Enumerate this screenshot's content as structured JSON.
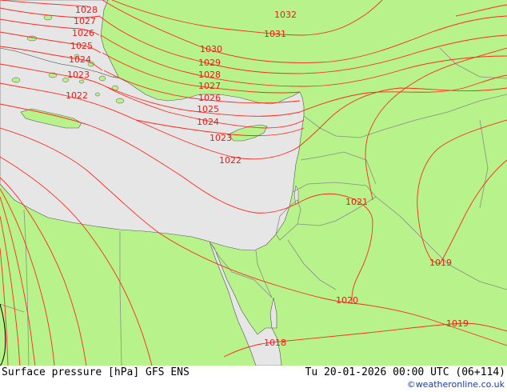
{
  "footer": {
    "left": "Surface pressure [hPa] GFS ENS",
    "right": "Tu 20-01-2026 00:00 UTC (06+114)",
    "credit": "©weatheronline.co.uk"
  },
  "colors": {
    "land": "#b7f28a",
    "sea": "#e6e6e6",
    "isobar": "#ff2a1f",
    "label": "#e0201c",
    "border": "#8c8c8c",
    "coast": "#555555"
  },
  "isobar_labels": [
    {
      "id": "1028a",
      "text": "1028"
    },
    {
      "id": "1027a",
      "text": "1027"
    },
    {
      "id": "1026a",
      "text": "1026"
    },
    {
      "id": "1025a",
      "text": "1025"
    },
    {
      "id": "1024a",
      "text": "1024"
    },
    {
      "id": "1023a",
      "text": "1023"
    },
    {
      "id": "1022a",
      "text": "1022"
    },
    {
      "id": "1032",
      "text": "1032"
    },
    {
      "id": "1031",
      "text": "1031"
    },
    {
      "id": "1030",
      "text": "1030"
    },
    {
      "id": "1029",
      "text": "1029"
    },
    {
      "id": "1028b",
      "text": "1028"
    },
    {
      "id": "1027b",
      "text": "1027"
    },
    {
      "id": "1026b",
      "text": "1026"
    },
    {
      "id": "1025b",
      "text": "1025"
    },
    {
      "id": "1024b",
      "text": "1024"
    },
    {
      "id": "1023b",
      "text": "1023"
    },
    {
      "id": "1022b",
      "text": "1022"
    },
    {
      "id": "1021",
      "text": "1021"
    },
    {
      "id": "1020",
      "text": "1020"
    },
    {
      "id": "1019a",
      "text": "1019"
    },
    {
      "id": "1019b",
      "text": "1019"
    },
    {
      "id": "1018",
      "text": "1018"
    }
  ]
}
